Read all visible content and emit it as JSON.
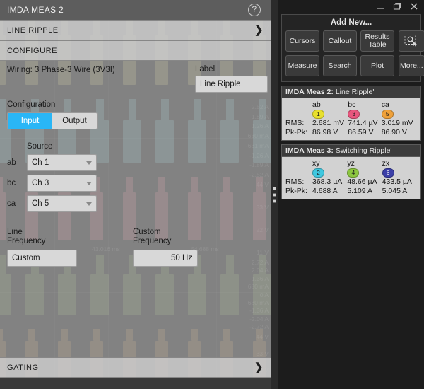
{
  "left_panel": {
    "title": "IMDA MEAS 2",
    "help_icon": "question-mark-circle-icon",
    "sections": {
      "line_ripple": {
        "label": "LINE RIPPLE",
        "chevron": "❯"
      },
      "configure": {
        "label": "CONFIGURE",
        "chevron": ""
      },
      "gating": {
        "label": "GATING",
        "chevron": "❯"
      }
    },
    "wiring": {
      "text": "Wiring: 3 Phase-3 Wire (3V3I)"
    },
    "label_field": {
      "caption": "Label",
      "value": "Line Ripple",
      "placeholder": "Label"
    },
    "configuration": {
      "caption": "Configuration",
      "input_label": "Input",
      "output_label": "Output",
      "selected": "Input",
      "accent_color": "#29b6f6"
    },
    "source": {
      "caption": "Source",
      "rows": [
        {
          "key": "ab",
          "value": "Ch 1"
        },
        {
          "key": "bc",
          "value": "Ch 3"
        },
        {
          "key": "ca",
          "value": "Ch 5"
        }
      ]
    },
    "line_frequency": {
      "caption_line1": "Line",
      "caption_line2": "Frequency",
      "value": "Custom"
    },
    "custom_frequency": {
      "caption_line1": "Custom",
      "caption_line2": "Frequency",
      "value": "50 Hz"
    }
  },
  "splitter": {
    "name": "panel-resize-handle"
  },
  "right_panel": {
    "window_controls": {
      "minimize": "minimize-icon",
      "restore": "restore-window-icon",
      "close": "close-icon"
    },
    "add_new": {
      "title": "Add New...",
      "buttons": [
        "Cursors",
        "Callout",
        "Results\nTable",
        "Measure",
        "Search",
        "Plot"
      ],
      "side_buttons": [
        {
          "icon": "zoom-select-area-icon",
          "label": ""
        },
        {
          "icon": "",
          "label": "More..."
        }
      ]
    },
    "results": [
      {
        "meas": "IMDA Meas 2:",
        "name": "Line Ripple'",
        "columns": [
          {
            "phase": "ab",
            "badge": "1",
            "badge_color": "#e8e02e"
          },
          {
            "phase": "bc",
            "badge": "3",
            "badge_color": "#e8567e"
          },
          {
            "phase": "ca",
            "badge": "5",
            "badge_color": "#efa13a"
          }
        ],
        "rows": [
          {
            "label": "RMS:",
            "values": [
              "2.681 mV",
              "741.4 µV",
              "3.019 mV"
            ]
          },
          {
            "label": "Pk-Pk:",
            "values": [
              "86.98 V",
              "86.59 V",
              "86.90 V"
            ]
          }
        ]
      },
      {
        "meas": "IMDA Meas 3:",
        "name": "Switching Ripple'",
        "columns": [
          {
            "phase": "xy",
            "badge": "2",
            "badge_color": "#3fc8e0"
          },
          {
            "phase": "yz",
            "badge": "4",
            "badge_color": "#8cc63f"
          },
          {
            "phase": "zx",
            "badge": "6",
            "badge_color": "#3b3fa8",
            "dark": true
          }
        ],
        "rows": [
          {
            "label": "RMS:",
            "values": [
              "368.3 µA",
              "48.66 µA",
              "433.5 µA"
            ]
          },
          {
            "label": "Pk-Pk:",
            "values": [
              "4.688 A",
              "5.109 A",
              "5.045 A"
            ]
          }
        ]
      }
    ]
  },
  "scope_background": {
    "bands": [
      {
        "name": "band-voltage-a",
        "color": "#d9cf9a",
        "labels": [
          "-11 V"
        ]
      },
      {
        "name": "band-current-a",
        "color": "#9fd3d6",
        "labels": [
          "2.52 A",
          "1.89 A",
          "1.26 A",
          "630 mA",
          "-631 mA",
          "-1.26 A",
          "-1.89 A",
          "-2.52 A"
        ]
      },
      {
        "name": "band-voltage-b",
        "color": "#e09aa8",
        "labels": [
          "44 V",
          "33 V",
          "22 V",
          "11 V"
        ]
      },
      {
        "name": "band-current-b",
        "color": "#a9bd8e",
        "labels": [
          "2.72 A",
          "2.04 A",
          "1.36 A",
          "680 mA",
          "0 A",
          "-680 mA",
          "-1.36 A",
          "-2.04 A",
          "-2.72 A"
        ]
      },
      {
        "name": "band-voltage-c",
        "color": "#cdab84",
        "labels": [
          "44 V",
          "33 V",
          "22 V",
          "11 V"
        ]
      }
    ],
    "time_labels": [
      "41.016 ms",
      "54.688 ms"
    ]
  }
}
